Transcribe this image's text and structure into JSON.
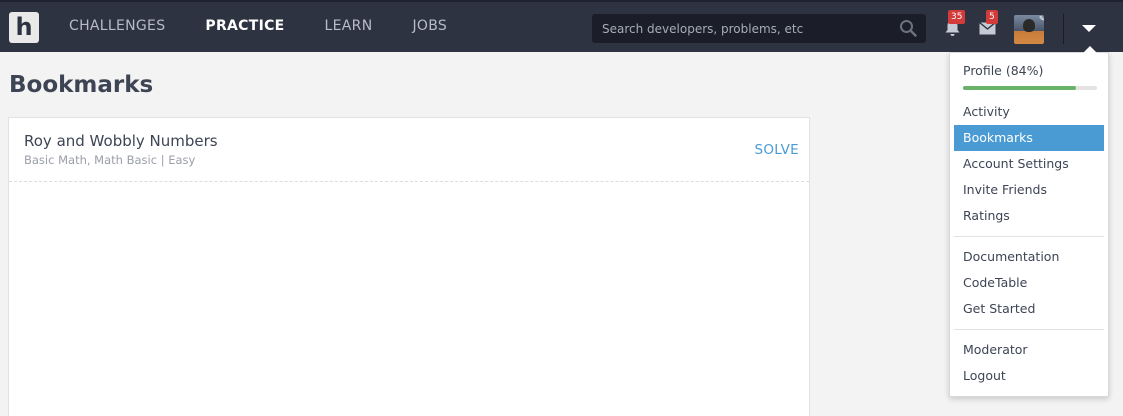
{
  "nav": {
    "items": [
      {
        "label": "CHALLENGES",
        "active": false
      },
      {
        "label": "PRACTICE",
        "active": true
      },
      {
        "label": "LEARN",
        "active": false
      },
      {
        "label": "JOBS",
        "active": false
      }
    ]
  },
  "search": {
    "placeholder": "Search developers, problems, etc"
  },
  "notifications": {
    "count": "35"
  },
  "messages": {
    "count": "5"
  },
  "page": {
    "title": "Bookmarks"
  },
  "bookmarks": [
    {
      "title": "Roy and Wobbly Numbers",
      "meta": "Basic Math, Math Basic | Easy",
      "action": "SOLVE"
    }
  ],
  "menu": {
    "profile_label": "Profile (84%)",
    "profile_progress": 0.84,
    "group1": [
      "Activity",
      "Bookmarks",
      "Account Settings",
      "Invite Friends",
      "Ratings"
    ],
    "active": "Bookmarks",
    "group2": [
      "Documentation",
      "CodeTable",
      "Get Started"
    ],
    "group3": [
      "Moderator",
      "Logout"
    ]
  },
  "colors": {
    "nav_bg": "#2e3342",
    "accent": "#4a9ad4",
    "progress": "#6ab26a",
    "badge": "#d33a3a"
  }
}
